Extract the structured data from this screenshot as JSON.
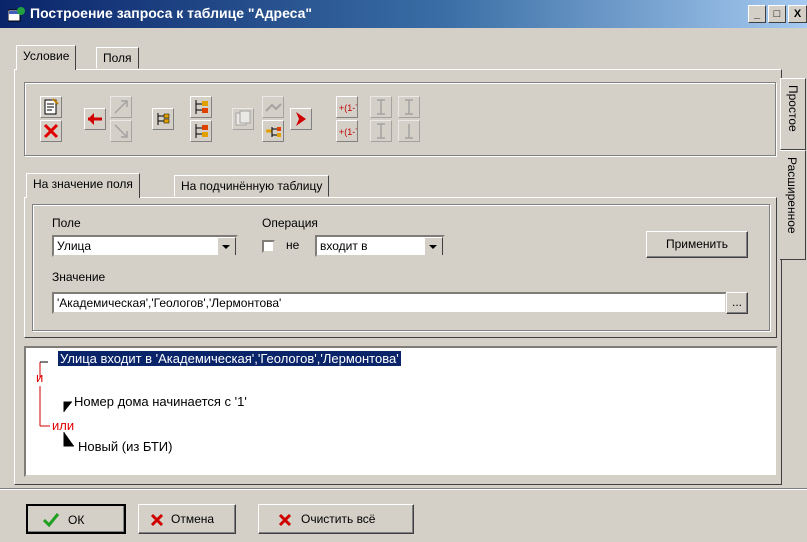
{
  "window": {
    "title": "Построение запроса к таблице \"Адреса\"",
    "buttons": [
      "_",
      "□",
      "X"
    ]
  },
  "main_tabs": [
    "Условие",
    "Поля"
  ],
  "side_tabs": [
    "Простое",
    "Расширенное"
  ],
  "toolbar": {
    "icons": [
      "edit-doc-icon",
      "delete-icon",
      "move-left-icon",
      "pointer-up-icon",
      "pointer-down-icon",
      "tree-collapse-icon",
      "tree-add-icon",
      "tree-add-child-icon",
      "copy-node-icon",
      "link-node-icon",
      "link-node-2-icon",
      "move-right-icon",
      "range-icon",
      "range-2-icon",
      "insert-up-icon",
      "insert-up-2-icon",
      "insert-down-icon",
      "insert-down-2-icon"
    ]
  },
  "sub_tabs": [
    "На значение поля",
    "На подчинённую таблицу"
  ],
  "form": {
    "field_label": "Поле",
    "field_value": "Улица",
    "operation_label": "Операция",
    "not_label": "не",
    "operation_value": "входит в",
    "apply_label": "Применить",
    "value_label": "Значение",
    "value_text": "'Академическая','Геологов','Лермонтова'",
    "browse_label": "..."
  },
  "tree": {
    "line1": "Улица входит в 'Академическая','Геологов','Лермонтова'",
    "and_label": "и",
    "line2": "Номер дома начинается с '1'",
    "or_label": "или",
    "line3": "Новый (из БТИ)"
  },
  "footer": {
    "ok_label": "ОК",
    "cancel_label": "Отмена",
    "clear_label": "Очистить всё"
  }
}
